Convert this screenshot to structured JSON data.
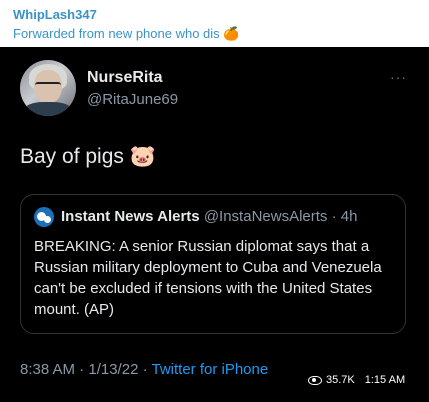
{
  "forward": {
    "user": "WhipLash347",
    "from_text": "Forwarded from new phone who dis",
    "from_emoji": "🍊"
  },
  "tweet": {
    "author_name": "NurseRita",
    "author_handle": "@RitaJune69",
    "more_label": "···",
    "text": "Bay of pigs 🐷",
    "quote": {
      "name": "Instant News Alerts",
      "handle_time": " @InstaNewsAlerts · 4h",
      "body": "BREAKING: A senior Russian diplomat says that a Russian military deployment to Cuba and Venezuela can't be excluded if tensions with the United States mount. (AP)"
    },
    "meta": {
      "timestamp": "8:38 AM · 1/13/22 · ",
      "source": "Twitter for iPhone"
    }
  },
  "overlay": {
    "views": "35.7K",
    "time": "1:15 AM"
  },
  "icons": {
    "avatar": "avatar-photo",
    "quote_avatar": "globe-icon",
    "more": "more-icon",
    "views": "eye-icon"
  }
}
